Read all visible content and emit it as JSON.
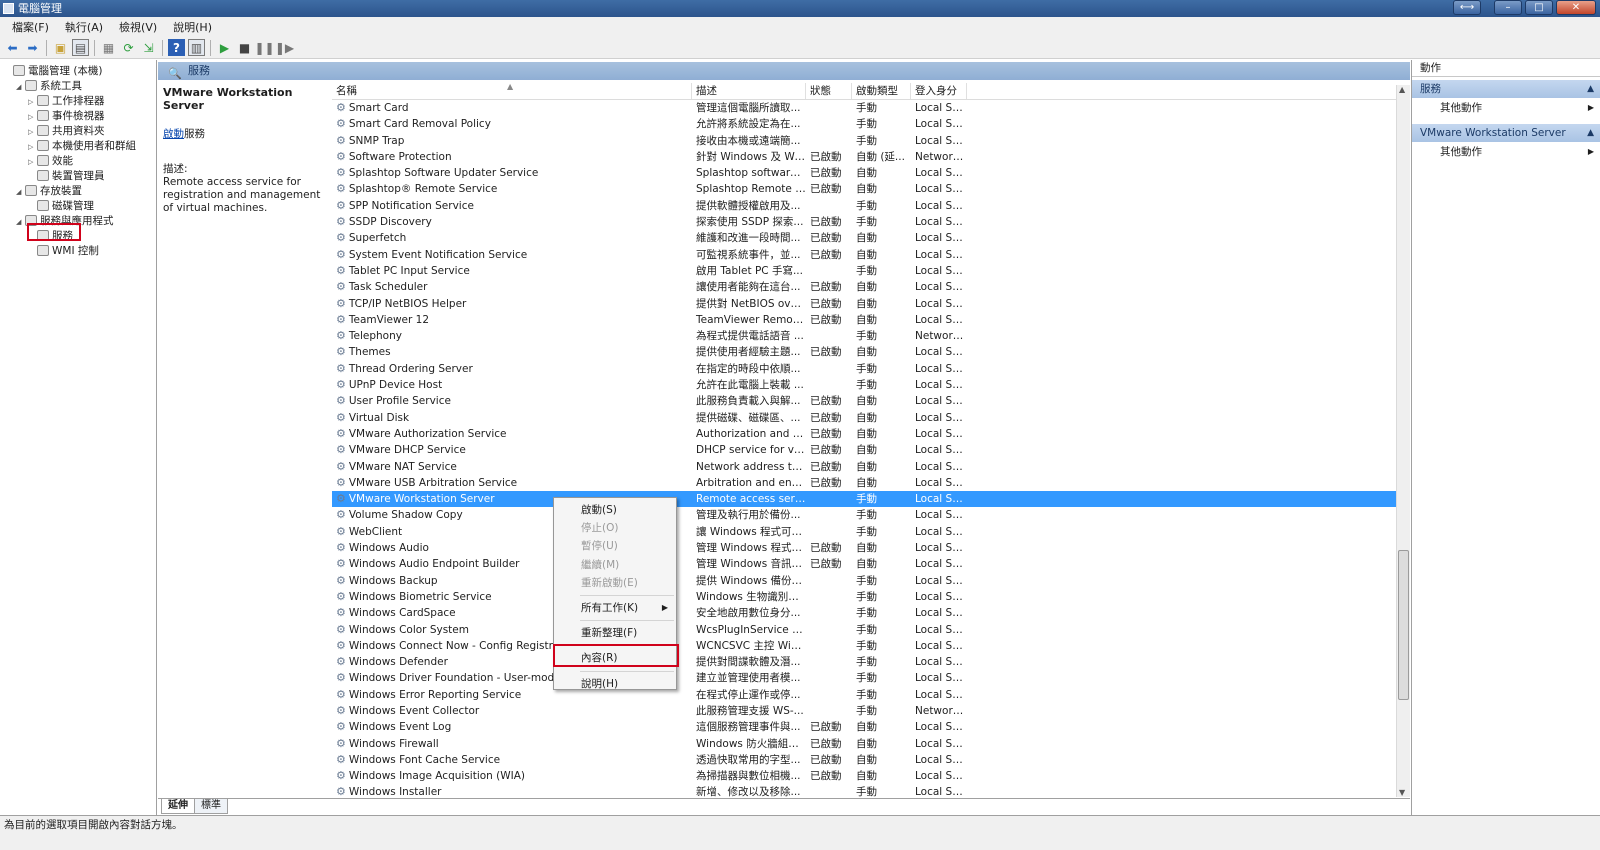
{
  "window": {
    "title": "電腦管理"
  },
  "menu": [
    "檔案(F)",
    "執行(A)",
    "檢視(V)",
    "說明(H)"
  ],
  "tree": [
    {
      "label": "電腦管理 (本機)",
      "level": 0,
      "twisty": ""
    },
    {
      "label": "系統工具",
      "level": 1,
      "twisty": "◢"
    },
    {
      "label": "工作排程器",
      "level": 2,
      "twisty": "▷"
    },
    {
      "label": "事件檢視器",
      "level": 2,
      "twisty": "▷"
    },
    {
      "label": "共用資料夾",
      "level": 2,
      "twisty": "▷"
    },
    {
      "label": "本機使用者和群組",
      "level": 2,
      "twisty": "▷"
    },
    {
      "label": "效能",
      "level": 2,
      "twisty": "▷"
    },
    {
      "label": "裝置管理員",
      "level": 2,
      "twisty": ""
    },
    {
      "label": "存放裝置",
      "level": 1,
      "twisty": "◢"
    },
    {
      "label": "磁碟管理",
      "level": 2,
      "twisty": ""
    },
    {
      "label": "服務與應用程式",
      "level": 1,
      "twisty": "◢"
    },
    {
      "label": "服務",
      "level": 2,
      "twisty": ""
    },
    {
      "label": "WMI 控制",
      "level": 2,
      "twisty": ""
    }
  ],
  "center": {
    "header": "服務",
    "selected_title": "VMware Workstation Server",
    "start_link": "啟動",
    "start_suffix": "服務",
    "desc_label": "描述:",
    "desc_text": "Remote access service for registration and management of virtual machines."
  },
  "columns": [
    "名稱",
    "描述",
    "狀態",
    "啟動類型",
    "登入身分"
  ],
  "services": [
    [
      "Smart Card",
      "管理這個電腦所讀取...",
      "",
      "手動",
      "Local Ser..."
    ],
    [
      "Smart Card Removal Policy",
      "允許將系統設定為在...",
      "",
      "手動",
      "Local Sys..."
    ],
    [
      "SNMP Trap",
      "接收由本機或遠端簡...",
      "",
      "手動",
      "Local Ser..."
    ],
    [
      "Software Protection",
      "針對 Windows 及 Wi...",
      "已啟動",
      "自動 (延...",
      "Network ..."
    ],
    [
      "Splashtop Software Updater Service",
      "Splashtop software u...",
      "已啟動",
      "自動",
      "Local Sys..."
    ],
    [
      "Splashtop® Remote Service",
      "Splashtop Remote S...",
      "已啟動",
      "自動",
      "Local Sys..."
    ],
    [
      "SPP Notification Service",
      "提供軟體授權啟用及...",
      "",
      "手動",
      "Local Ser..."
    ],
    [
      "SSDP Discovery",
      "探索使用 SSDP 探索...",
      "已啟動",
      "手動",
      "Local Ser..."
    ],
    [
      "Superfetch",
      "維護和改進一段時間...",
      "已啟動",
      "自動",
      "Local Sys..."
    ],
    [
      "System Event Notification Service",
      "可監視系統事件，並...",
      "已啟動",
      "自動",
      "Local Sys..."
    ],
    [
      "Tablet PC Input Service",
      "啟用 Tablet PC 手寫...",
      "",
      "手動",
      "Local Sys..."
    ],
    [
      "Task Scheduler",
      "讓使用者能夠在這台...",
      "已啟動",
      "自動",
      "Local Sys..."
    ],
    [
      "TCP/IP NetBIOS Helper",
      "提供對 NetBIOS over ...",
      "已啟動",
      "自動",
      "Local Ser..."
    ],
    [
      "TeamViewer 12",
      "TeamViewer Remote...",
      "已啟動",
      "自動",
      "Local Sys..."
    ],
    [
      "Telephony",
      "為程式提供電話語音 ...",
      "",
      "手動",
      "Network ..."
    ],
    [
      "Themes",
      "提供使用者經驗主題...",
      "已啟動",
      "自動",
      "Local Sys..."
    ],
    [
      "Thread Ordering Server",
      "在指定的時段中依順...",
      "",
      "手動",
      "Local Ser..."
    ],
    [
      "UPnP Device Host",
      "允許在此電腦上裝載 ...",
      "",
      "手動",
      "Local Ser..."
    ],
    [
      "User Profile Service",
      "此服務負責載入與解...",
      "已啟動",
      "自動",
      "Local Sys..."
    ],
    [
      "Virtual Disk",
      "提供磁碟、磁碟區、...",
      "已啟動",
      "自動",
      "Local Sys..."
    ],
    [
      "VMware Authorization Service",
      "Authorization and au...",
      "已啟動",
      "自動",
      "Local Sys..."
    ],
    [
      "VMware DHCP Service",
      "DHCP service for virt...",
      "已啟動",
      "自動",
      "Local Sys..."
    ],
    [
      "VMware NAT Service",
      "Network address tra...",
      "已啟動",
      "自動",
      "Local Sys..."
    ],
    [
      "VMware USB Arbitration Service",
      "Arbitration and enu...",
      "已啟動",
      "自動",
      "Local Sys..."
    ],
    [
      "VMware Workstation Server",
      "Remote access servic...",
      "",
      "手動",
      "Local Sys..."
    ],
    [
      "Volume Shadow Copy",
      "管理及執行用於備份...",
      "",
      "手動",
      "Local Sys..."
    ],
    [
      "WebClient",
      "讓 Windows 程式可建...",
      "",
      "手動",
      "Local Ser..."
    ],
    [
      "Windows Audio",
      "管理 Windows 程式的...",
      "已啟動",
      "自動",
      "Local Ser..."
    ],
    [
      "Windows Audio Endpoint Builder",
      "管理 Windows 音訊服...",
      "已啟動",
      "自動",
      "Local Sys..."
    ],
    [
      "Windows Backup",
      "提供 Windows 備份與...",
      "",
      "手動",
      "Local Sys..."
    ],
    [
      "Windows Biometric Service",
      "Windows 生物識別服...",
      "",
      "手動",
      "Local Sys..."
    ],
    [
      "Windows CardSpace",
      "安全地啟用數位身分...",
      "",
      "手動",
      "Local Sys..."
    ],
    [
      "Windows Color System",
      "WcsPlugInService 服...",
      "",
      "手動",
      "Local Ser..."
    ],
    [
      "Windows Connect Now - Config Registrar",
      "WCNCSVC 主控 Win...",
      "",
      "手動",
      "Local Ser..."
    ],
    [
      "Windows Defender",
      "提供對間諜軟體及潛...",
      "",
      "手動",
      "Local Sys..."
    ],
    [
      "Windows Driver Foundation - User-mode Dr...",
      "建立並管理使用者模...",
      "",
      "手動",
      "Local Sys..."
    ],
    [
      "Windows Error Reporting Service",
      "在程式停止運作或停...",
      "",
      "手動",
      "Local Sys..."
    ],
    [
      "Windows Event Collector",
      "此服務管理支援 WS-...",
      "",
      "手動",
      "Network ..."
    ],
    [
      "Windows Event Log",
      "這個服務管理事件與...",
      "已啟動",
      "自動",
      "Local Ser..."
    ],
    [
      "Windows Firewall",
      "Windows 防火牆組由...",
      "已啟動",
      "自動",
      "Local Ser..."
    ],
    [
      "Windows Font Cache Service",
      "透過快取常用的字型...",
      "已啟動",
      "自動",
      "Local Ser..."
    ],
    [
      "Windows Image Acquisition (WIA)",
      "為掃描器與數位相機...",
      "已啟動",
      "自動",
      "Local Ser..."
    ],
    [
      "Windows Installer",
      "新增、修改以及移除...",
      "",
      "手動",
      "Local Sys..."
    ]
  ],
  "selected_index": 24,
  "tabs": [
    "延伸",
    "標準"
  ],
  "actions": {
    "header": "動作",
    "group1": "服務",
    "group1_item": "其他動作",
    "group2": "VMware Workstation Server",
    "group2_item": "其他動作"
  },
  "context_menu": [
    {
      "label": "啟動(S)",
      "disabled": false
    },
    {
      "label": "停止(O)",
      "disabled": true
    },
    {
      "label": "暫停(U)",
      "disabled": true
    },
    {
      "label": "繼續(M)",
      "disabled": true
    },
    {
      "label": "重新啟動(E)",
      "disabled": true
    },
    {
      "sep": true
    },
    {
      "label": "所有工作(K)",
      "disabled": false,
      "sub": true
    },
    {
      "sep": true
    },
    {
      "label": "重新整理(F)",
      "disabled": false
    },
    {
      "sep": true
    },
    {
      "label": "內容(R)",
      "disabled": false
    },
    {
      "sep": true
    },
    {
      "label": "說明(H)",
      "disabled": false
    }
  ],
  "status": "為目前的選取項目開啟內容對話方塊。"
}
